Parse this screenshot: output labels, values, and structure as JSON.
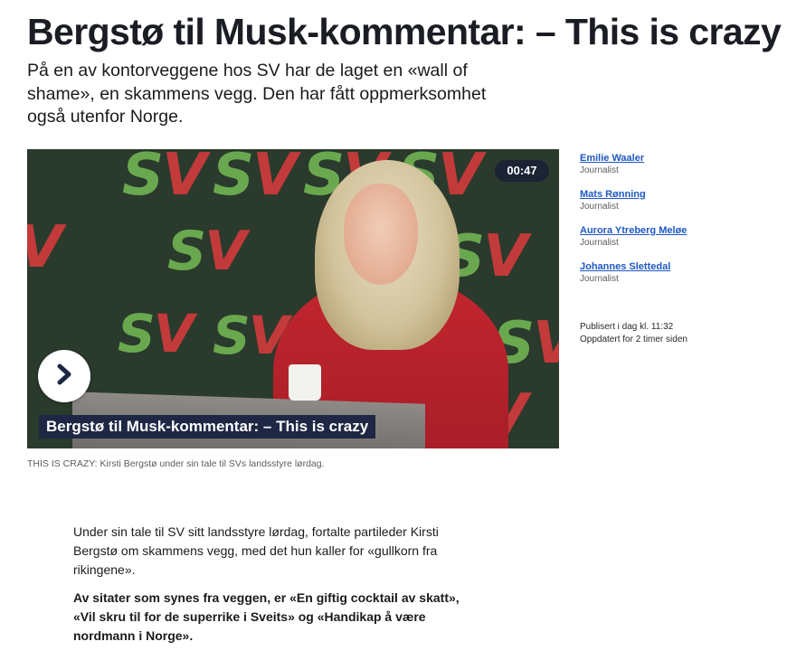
{
  "article": {
    "headline": "Bergstø til Musk-kommentar: – This is crazy",
    "lede": "På en av kontorveggene hos SV har de laget en «wall of shame», en skammens vegg. Den har fått oppmerksomhet også utenfor Norge."
  },
  "video": {
    "duration": "00:47",
    "title_overlay": "Bergstø til Musk-kommentar: – This is crazy",
    "play_icon": "play-chevron-icon",
    "sign_s": "S",
    "sign_v": "V",
    "caption": "THIS IS CRAZY: Kirsti Bergstø under sin tale til SVs landsstyre lørdag."
  },
  "byline": {
    "authors": [
      {
        "name": "Emilie Waaler",
        "role": "Journalist"
      },
      {
        "name": "Mats Rønning",
        "role": "Journalist"
      },
      {
        "name": "Aurora Ytreberg Meløe",
        "role": "Journalist"
      },
      {
        "name": "Johannes Slettedal",
        "role": "Journalist"
      }
    ],
    "published": "Publisert i dag kl. 11:32",
    "updated": "Oppdatert for 2 timer siden"
  },
  "body": {
    "p1": "Under sin tale til SV sitt landsstyre lørdag, fortalte partileder Kirsti Bergstø om skammens vegg, med det hun kaller for «gullkorn fra rikingene».",
    "p2": "Av sitater som synes fra veggen, er «En giftig cocktail av skatt», «Vil skru til for de superrike i Sveits» og «Handikap å være nordmann i Norge»."
  },
  "colors": {
    "headline": "#1b1d24",
    "link": "#1f58c2",
    "video_overlay": "#1e2743",
    "sv_green": "#6aa84f",
    "sv_red": "#c23a3a"
  }
}
